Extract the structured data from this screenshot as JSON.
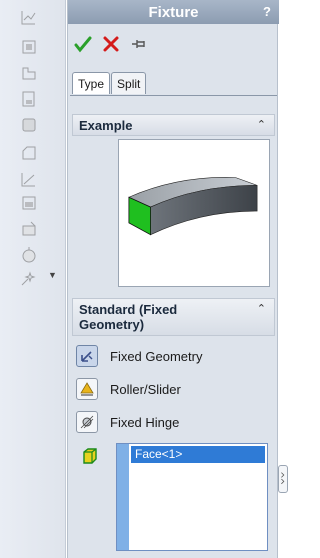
{
  "panel": {
    "title": "Fixture",
    "help_icon": "?",
    "actions": [
      "ok-check-icon",
      "cancel-x-icon",
      "pushpin-icon"
    ]
  },
  "tabs": [
    {
      "label": "Type",
      "active": true
    },
    {
      "label": "Split",
      "active": false
    }
  ],
  "example": {
    "heading": "Example",
    "chevron": "⌃"
  },
  "standard": {
    "heading": "Standard (Fixed Geometry)",
    "chevron": "⌃",
    "options": [
      {
        "label": "Fixed Geometry",
        "icon": "fixed-geometry-icon",
        "selected": true
      },
      {
        "label": "Roller/Slider",
        "icon": "roller-slider-icon",
        "selected": false
      },
      {
        "label": "Fixed Hinge",
        "icon": "fixed-hinge-icon",
        "selected": false
      }
    ]
  },
  "selection": {
    "icon": "face-selection-icon",
    "items": [
      "Face<1>"
    ]
  },
  "colors": {
    "accent": "#2f7bd6",
    "title_bar": "#9aaabd",
    "panel_bg": "#dde3eb",
    "face_green": "#1fbf1f"
  }
}
